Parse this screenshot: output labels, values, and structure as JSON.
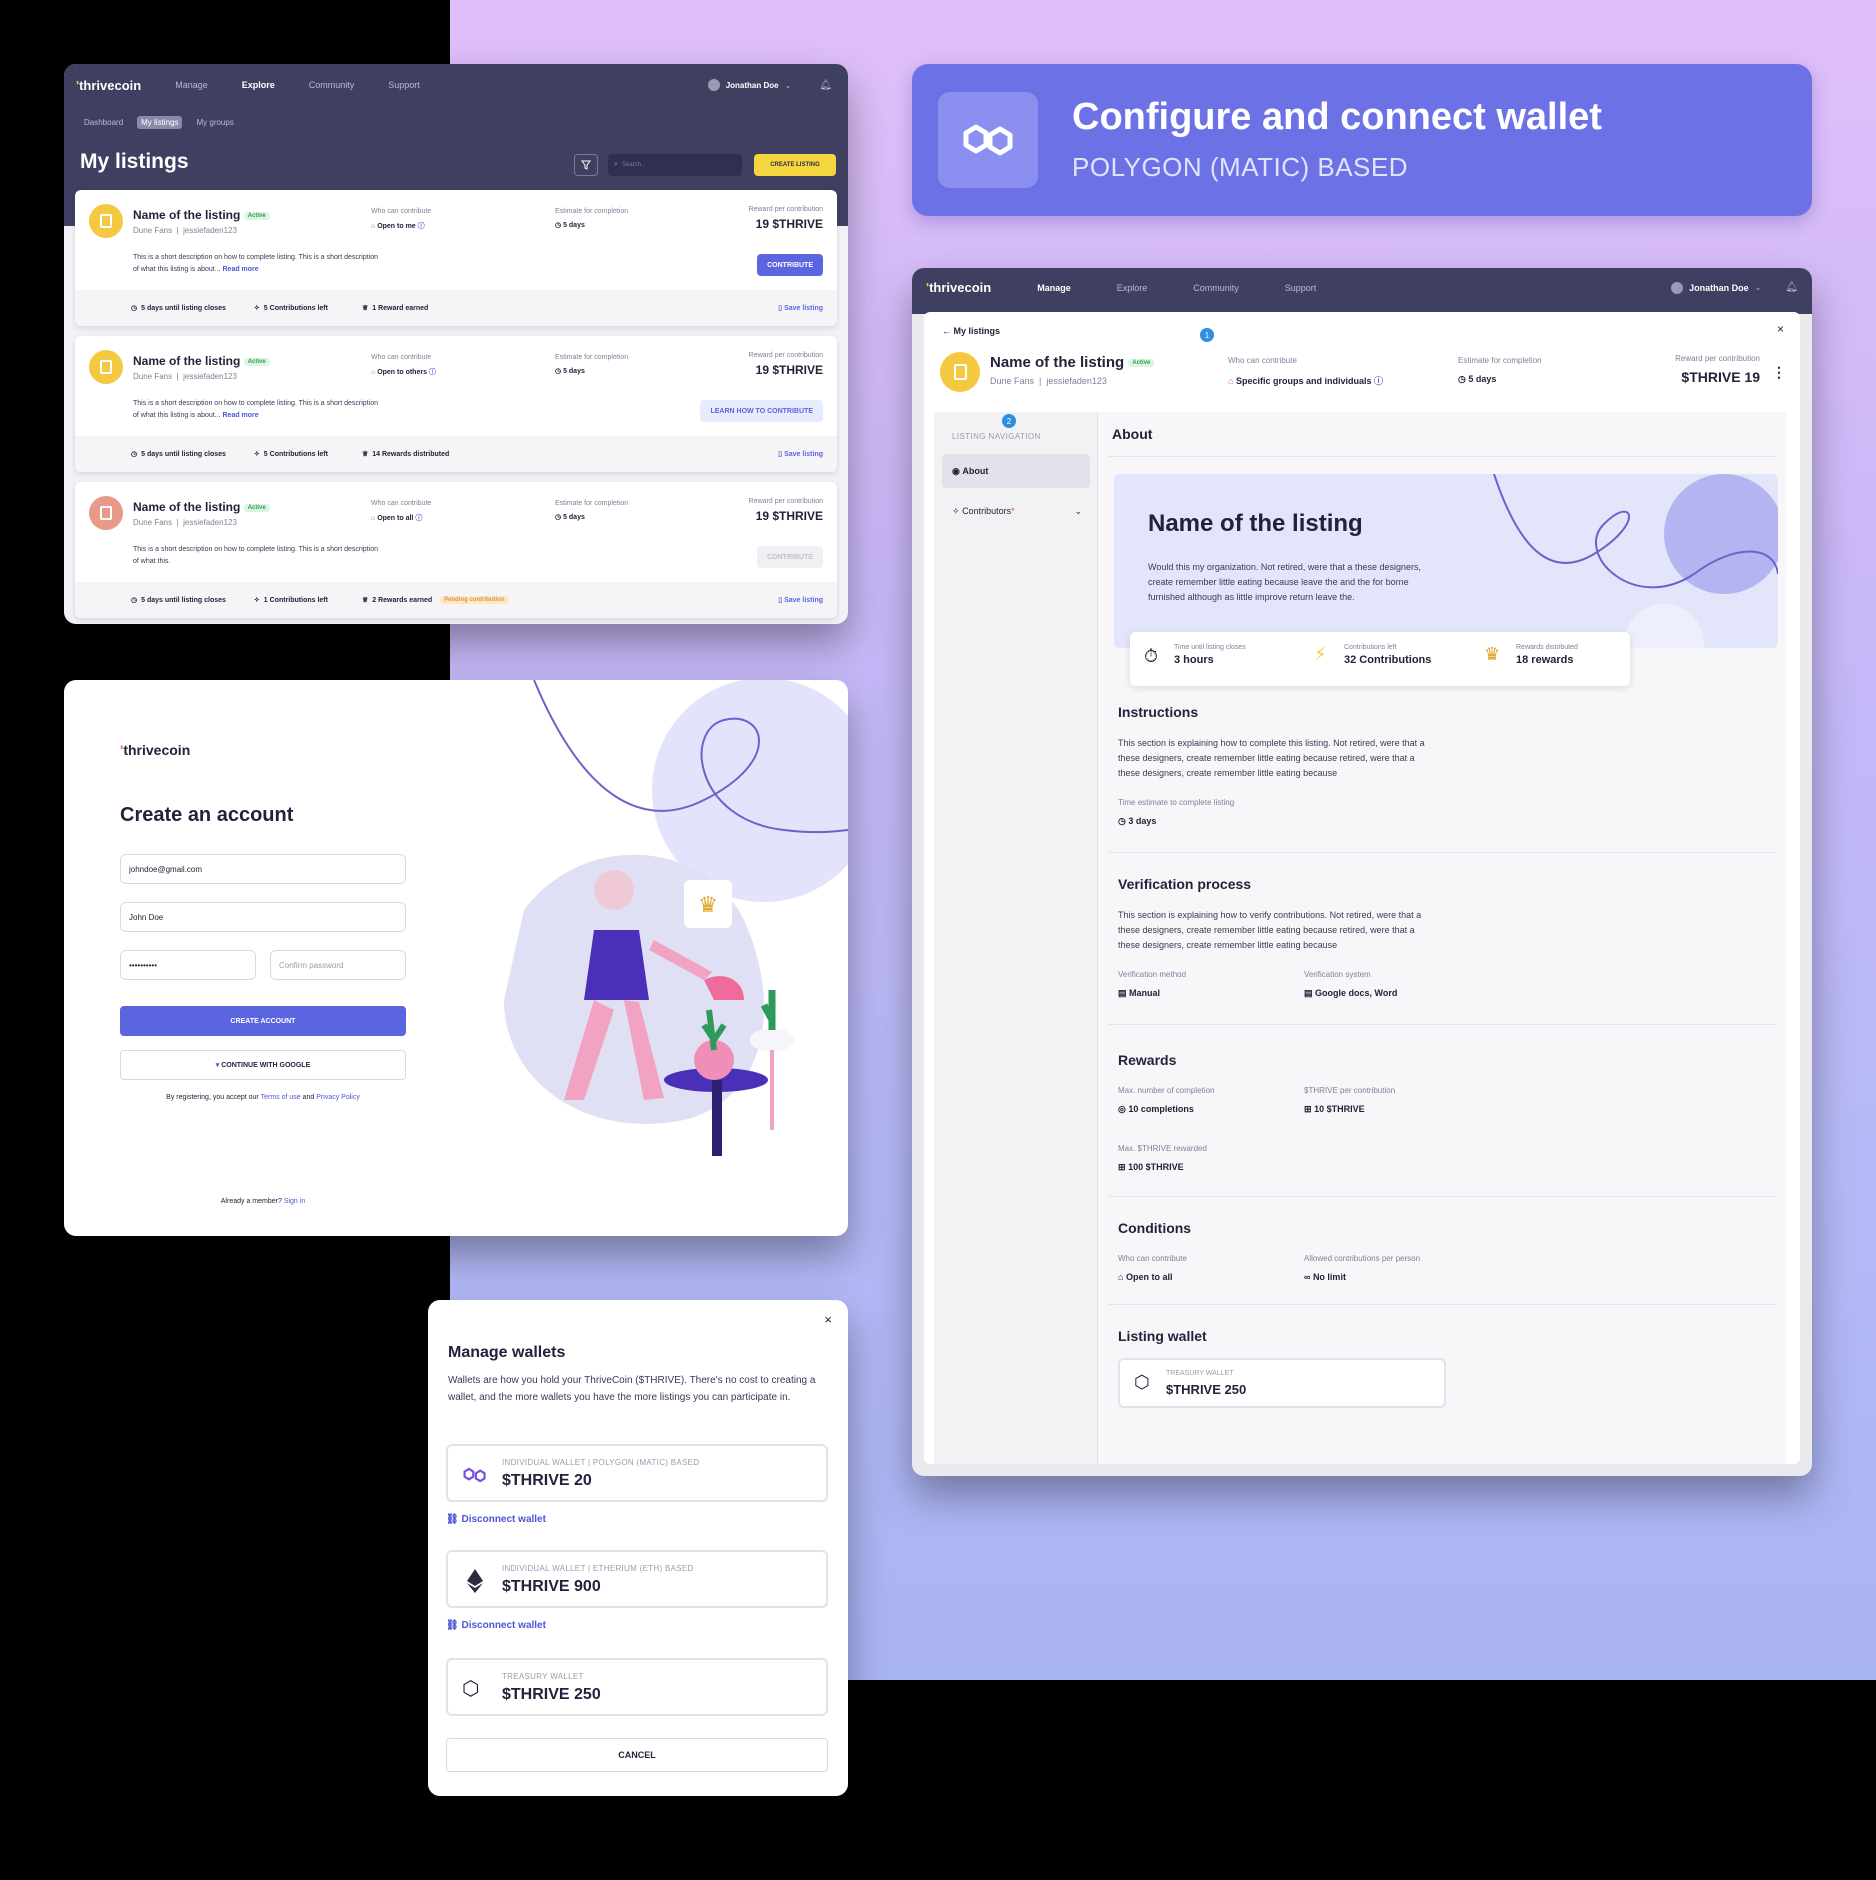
{
  "brand": {
    "logo": "thrivecoin"
  },
  "listings_panel": {
    "nav": [
      "Manage",
      "Explore",
      "Community",
      "Support"
    ],
    "user": "Jonathan Doe",
    "subtabs": [
      "Dashboard",
      "My listings",
      "My groups"
    ],
    "title": "My listings",
    "search_placeholder": "Search...",
    "create_label": "CREATE LISTING",
    "cards": [
      {
        "title": "Name of the listing",
        "status": "Active",
        "group": "Dune Fans",
        "user": "jessiefaden123",
        "desc": "This is a short description on how to complete listing. This is a short description of what this listing is about...",
        "read_more": "Read more",
        "who_label": "Who can contribute",
        "who": "Open to me",
        "est_label": "Estimate for completion",
        "est": "5 days",
        "reward_label": "Reward per contribution",
        "reward": "19 $THRIVE",
        "action": "CONTRIBUTE",
        "f1": "5 days until listing closes",
        "f2": "5 Contributions left",
        "f3": "1 Reward earned",
        "badge": "",
        "save": "Save listing"
      },
      {
        "title": "Name of the listing",
        "status": "Active",
        "group": "Dune Fans",
        "user": "jessiefaden123",
        "desc": "This is a short description on how to complete listing. This is a short description of what this listing is about...",
        "read_more": "Read more",
        "who_label": "Who can contribute",
        "who": "Open to others",
        "est_label": "Estimate for completion",
        "est": "5 days",
        "reward_label": "Reward per contribution",
        "reward": "19 $THRIVE",
        "action": "LEARN HOW TO CONTRIBUTE",
        "f1": "5 days until listing closes",
        "f2": "5 Contributions left",
        "f3": "14 Rewards distributed",
        "badge": "",
        "save": "Save listing"
      },
      {
        "title": "Name of the listing",
        "status": "Active",
        "group": "Dune Fans",
        "user": "jessiefaden123",
        "desc": "This is a short description on how to complete listing. This is a short description of what this.",
        "read_more": "",
        "who_label": "Who can contribute",
        "who": "Open to all",
        "est_label": "Estimate for completion",
        "est": "5 days",
        "reward_label": "Reward per contribution",
        "reward": "19 $THRIVE",
        "action": "CONTRIBUTE",
        "f1": "5 days until listing closes",
        "f2": "1 Contributions left",
        "f3": "2 Rewards earned",
        "badge": "Pending contribution",
        "save": "Save listing"
      }
    ]
  },
  "banner": {
    "title": "Configure and connect wallet",
    "subtitle": "POLYGON (MATIC) BASED"
  },
  "detail": {
    "nav": [
      "Manage",
      "Explore",
      "Community",
      "Support"
    ],
    "user": "Jonathan Doe",
    "back": "My listings",
    "step1": "1",
    "step2": "2",
    "title": "Name of the listing",
    "status": "Active",
    "group": "Dune Fans",
    "owner": "jessiefaden123",
    "who_label": "Who can contribute",
    "who": "Specific groups and individuals",
    "est_label": "Estimate for completion",
    "est": "5 days",
    "reward_label": "Reward per contribution",
    "reward": "$THRIVE 19",
    "nav_label": "LISTING NAVIGATION",
    "nav_about": "About",
    "nav_contrib": "Contributors",
    "about": "About",
    "hero_title": "Name of the listing",
    "hero_text": "Would this my organization. Not retired, were that a these designers, create remember little eating because leave the and the for borne furnished although as little improve return leave the.",
    "stat1_label": "Time until listing closes",
    "stat1": "3 hours",
    "stat2_label": "Contributions left",
    "stat2": "32 Contributions",
    "stat3_label": "Rewards distributed",
    "stat3": "18 rewards",
    "instr_title": "Instructions",
    "instr_text": "This section is explaining how to complete this listing. Not retired, were that a these designers, create remember little eating because retired, were that a these designers, create remember little eating because",
    "time_label": "Time estimate to complete listing",
    "time": "3 days",
    "ver_title": "Verification process",
    "ver_text": "This section is explaining how to verify contributions. Not retired, were that a these designers, create remember little eating because retired, were that a these designers, create remember little eating because",
    "vm_label": "Verification method",
    "vm": "Manual",
    "vs_label": "Verification system",
    "vs": "Google docs, Word",
    "rew_title": "Rewards",
    "max_label": "Max. number of completion",
    "max": "10 completions",
    "per_label": "$THRIVE per contribution",
    "per": "10 $THRIVE",
    "maxr_label": "Max. $THRIVE rewarded",
    "maxr": "100 $THRIVE",
    "cond_title": "Conditions",
    "cw_label": "Who can contribute",
    "cw": "Open to all",
    "ac_label": "Allowed contributions per person",
    "ac": "No limit",
    "wallet_title": "Listing wallet",
    "wallet_label": "TREASURY WALLET",
    "wallet_val": "$THRIVE 250"
  },
  "signup": {
    "title": "Create an account",
    "email": "johndoe@gmail.com",
    "name": "John Doe",
    "password": "••••••••••",
    "confirm_placeholder": "Confirm password",
    "create": "CREATE ACCOUNT",
    "google": "CONTINUE WITH GOOGLE",
    "terms_pre": "By registering, you accept our",
    "terms": "Terms of use",
    "and": "and",
    "privacy": "Privacy Policy",
    "member": "Already a member?",
    "signin": "Sign in"
  },
  "wallets": {
    "title": "Manage wallets",
    "text": "Wallets are how you hold your ThriveCoin ($THRIVE). There's no cost to creating a wallet, and the more wallets you have the more listings you can participate in.",
    "w1_label": "INDIVIDUAL WALLET | POLYGON (MATIC) BASED",
    "w1": "$THRIVE 20",
    "w2_label": "INDIVIDUAL WALLET | ETHERIUM (ETH) BASED",
    "w2": "$THRIVE 900",
    "w3_label": "TREASURY WALLET",
    "w3": "$THRIVE 250",
    "disconnect": "Disconnect wallet",
    "cancel": "CANCEL"
  },
  "colors": {
    "accent": "#5c65e0",
    "header": "#3f4061",
    "yellow": "#f5c842",
    "banner": "#6c72e6"
  }
}
